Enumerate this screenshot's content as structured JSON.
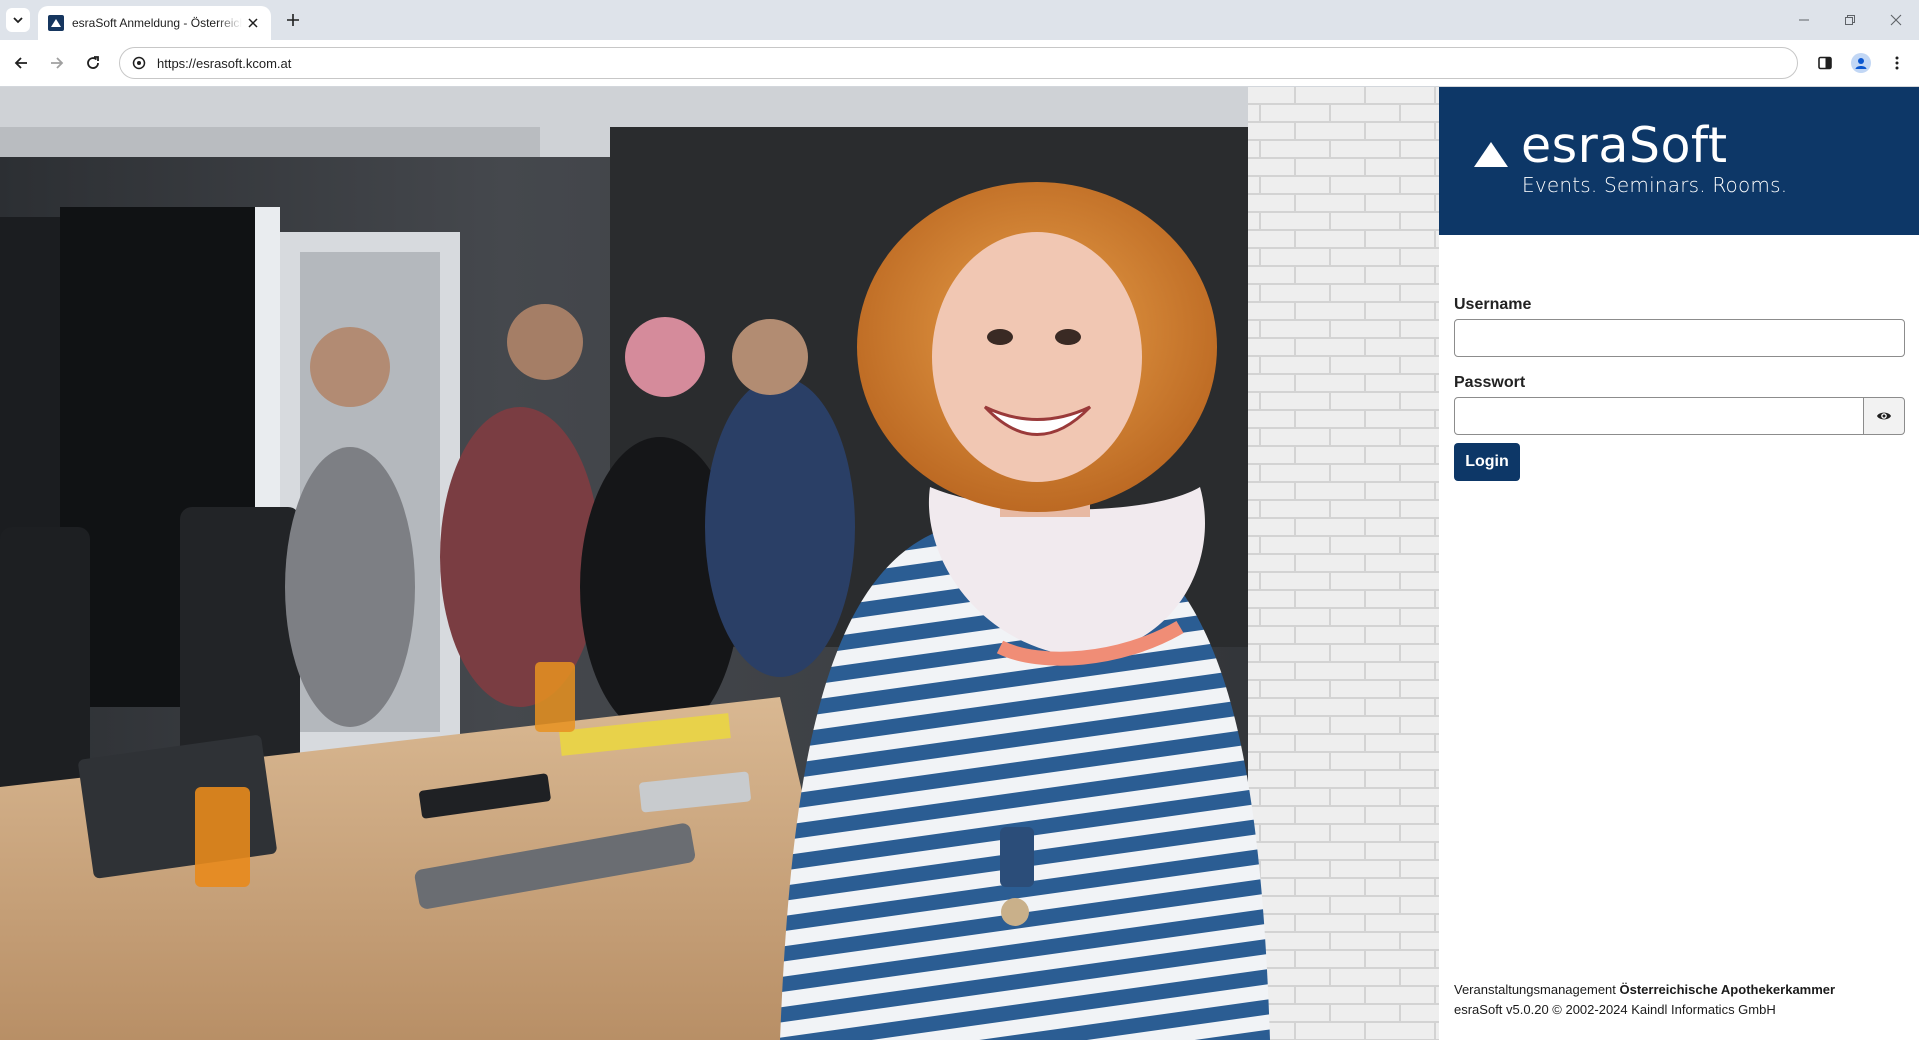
{
  "browser": {
    "tab_title": "esraSoft Anmeldung - Österreichische Apothekerkammer",
    "url": "https://esrasoft.kcom.at"
  },
  "brand": {
    "name": "esraSoft",
    "tagline": "Events. Seminars. Rooms.",
    "color": "#0d3767"
  },
  "login": {
    "username_label": "Username",
    "username_value": "",
    "password_label": "Passwort",
    "password_value": "",
    "submit_label": "Login"
  },
  "footer": {
    "line1_prefix": "Veranstaltungsmanagement",
    "line1_org": "Österreichische Apothekerkammer",
    "line2": "esraSoft v5.0.20 © 2002-2024 Kaindl Informatics GmbH"
  }
}
